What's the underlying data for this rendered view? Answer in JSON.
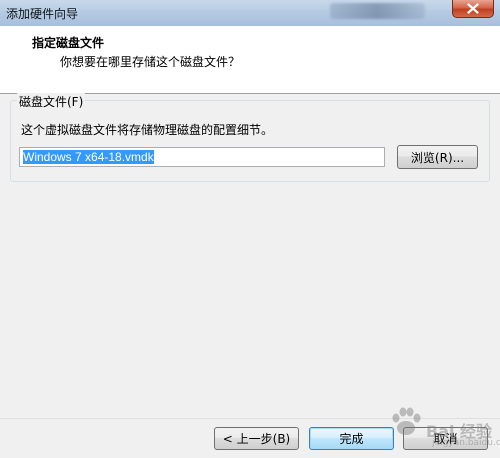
{
  "window": {
    "title": "添加硬件向导"
  },
  "header": {
    "title": "指定磁盘文件",
    "subtitle": "你想要在哪里存储这个磁盘文件？"
  },
  "disk_file_group": {
    "label": "磁盘文件(F)",
    "description": "这个虚拟磁盘文件将存储物理磁盘的配置细节。",
    "file_value": "Windows 7 x64-18.vmdk",
    "browse_label": "浏览(R)..."
  },
  "footer": {
    "back_label": "< 上一步(B)",
    "finish_label": "完成",
    "cancel_label": "取消"
  },
  "watermark": {
    "text": "Bai 经验",
    "sub": "jingyan.baidu.com"
  },
  "colors": {
    "selection": "#3399ff",
    "default_button_border": "#3c7fb1",
    "close_button": "#c0401f"
  },
  "icons": {
    "close": "close-icon",
    "watermark_logo": "paw-icon"
  }
}
